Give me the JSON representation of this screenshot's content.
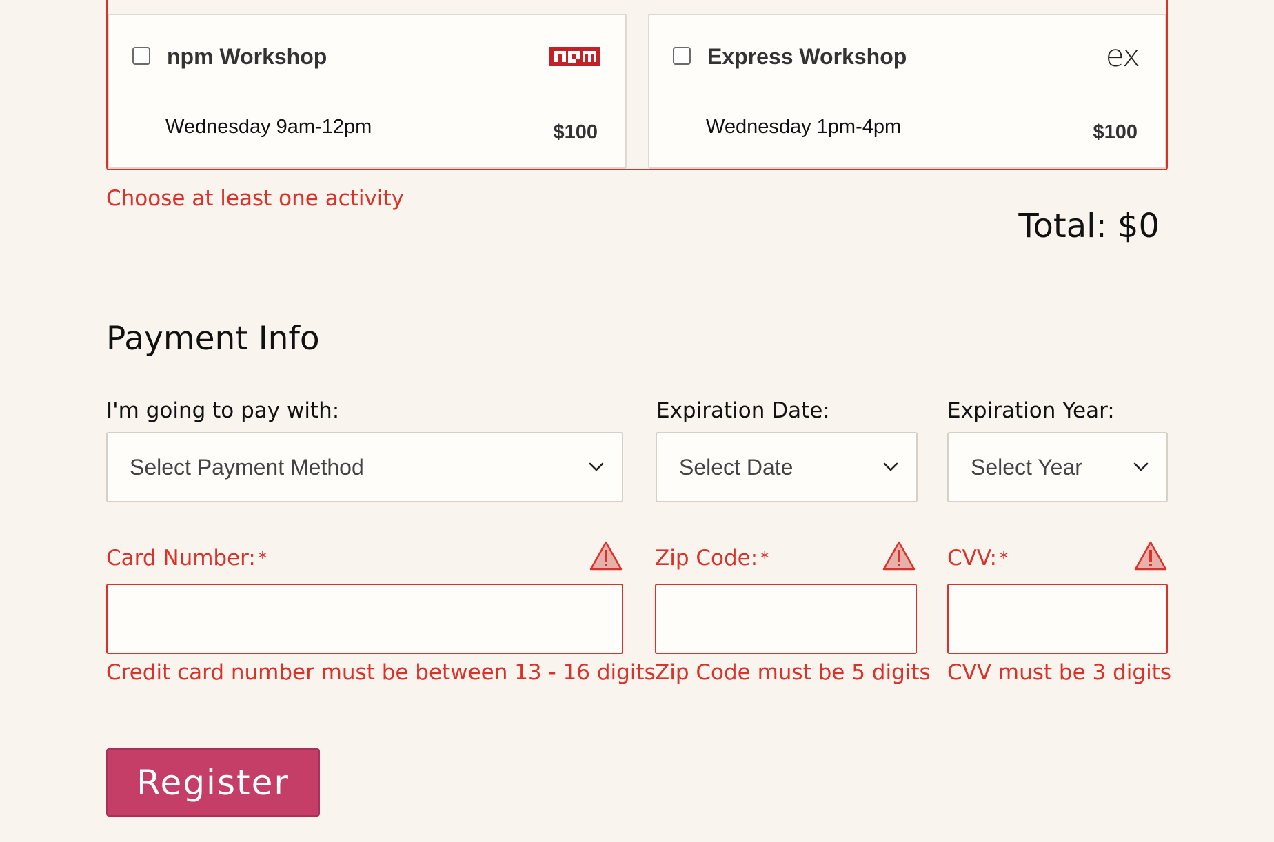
{
  "activities": [
    {
      "title": "npm Workshop",
      "time": "Wednesday 9am-12pm",
      "price": "$100",
      "logo": "npm-logo",
      "checked": false
    },
    {
      "title": "Express Workshop",
      "time": "Wednesday 1pm-4pm",
      "price": "$100",
      "logo": "express-logo",
      "logo_text": "ex",
      "checked": false
    }
  ],
  "activities_error": "Choose at least one activity",
  "total": "Total: $0",
  "payment": {
    "section_title": "Payment Info",
    "method_label": "I'm going to pay with:",
    "method_value": "Select Payment Method",
    "exp_date_label": "Expiration Date:",
    "exp_date_value": "Select Date",
    "exp_year_label": "Expiration Year:",
    "exp_year_value": "Select Year",
    "card_label": "Card Number:",
    "zip_label": "Zip Code:",
    "cvv_label": "CVV:",
    "required_marker": "*",
    "card_value": "",
    "zip_value": "",
    "cvv_value": "",
    "card_error": "Credit card number must be between 13 - 16 digits",
    "zip_error": "Zip Code must be 5 digits",
    "cvv_error": "CVV must be 3 digits"
  },
  "register_label": "Register",
  "colors": {
    "background": "#f9f4ed",
    "error": "#d8322a",
    "button": "#c43e68",
    "npm_red": "#c12127"
  },
  "icons": [
    "chevron-down-icon",
    "warning-icon",
    "npm-logo",
    "express-logo"
  ]
}
